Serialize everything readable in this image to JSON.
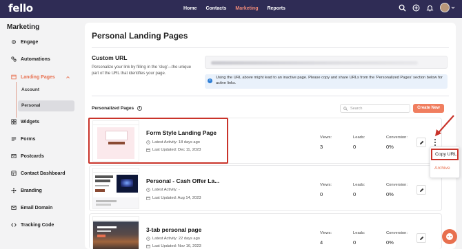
{
  "app": {
    "logo": "fello"
  },
  "topnav": {
    "items": [
      {
        "label": "Home"
      },
      {
        "label": "Contacts"
      },
      {
        "label": "Marketing"
      },
      {
        "label": "Reports"
      }
    ],
    "active": "Marketing"
  },
  "topicons": [
    "search-icon",
    "plus-circle-icon",
    "bell-icon",
    "avatar",
    "chevron-down-icon"
  ],
  "sidebar": {
    "title": "Marketing",
    "items": [
      {
        "label": "Engage",
        "icon": "gear-icon"
      },
      {
        "label": "Automations",
        "icon": "automation-icon"
      },
      {
        "label": "Landing Pages",
        "icon": "landing-page-icon",
        "expanded": true
      },
      {
        "label": "Widgets",
        "icon": "widget-icon"
      },
      {
        "label": "Forms",
        "icon": "form-icon"
      },
      {
        "label": "Postcards",
        "icon": "postcard-icon"
      },
      {
        "label": "Contact Dashboard",
        "icon": "dashboard-icon"
      },
      {
        "label": "Branding",
        "icon": "branding-icon"
      },
      {
        "label": "Email Domain",
        "icon": "email-icon"
      },
      {
        "label": "Tracking Code",
        "icon": "code-icon"
      }
    ],
    "subitems": [
      {
        "label": "Account"
      },
      {
        "label": "Personal",
        "selected": true
      }
    ]
  },
  "main": {
    "title": "Personal Landing Pages",
    "custom_url": {
      "title": "Custom URL",
      "description": "Personalize your link by filling in the 'slug'—the unique part of the URL that identifies your page.",
      "info": "Using the URL above might lead to an inactive page. Please copy and share URLs from the 'Personalized Pages' section below for active links."
    },
    "personalized_label": "Personalized Pages",
    "search_placeholder": "Search",
    "create_label": "Create New",
    "stat_labels": {
      "views": "Views:",
      "leads": "Leads:",
      "conversion": "Conversion:"
    },
    "pages": [
      {
        "title": "Form Style Landing Page",
        "activity": "Latest Activity: 18 days ago",
        "updated": "Last Updated: Dec 11, 2023",
        "views": "3",
        "leads": "0",
        "conversion": "0%"
      },
      {
        "title": "Personal - Cash Offer La...",
        "activity": "Latest Activity: -",
        "updated": "Last Updated: Aug 14, 2023",
        "views": "0",
        "leads": "0",
        "conversion": "0%"
      },
      {
        "title": "3-tab personal page",
        "activity": "Latest Activity: 22 days ago",
        "updated": "Last Updated: Nov 16, 2023",
        "views": "4",
        "leads": "0",
        "conversion": "0%"
      }
    ]
  },
  "dropdown": {
    "copy_url": "Copy URL",
    "archive": "Archive"
  },
  "colors": {
    "topbar": "#2f2c55",
    "accent": "#e8704f",
    "highlight": "#c9332a",
    "info_bg": "#e9f1fb"
  }
}
